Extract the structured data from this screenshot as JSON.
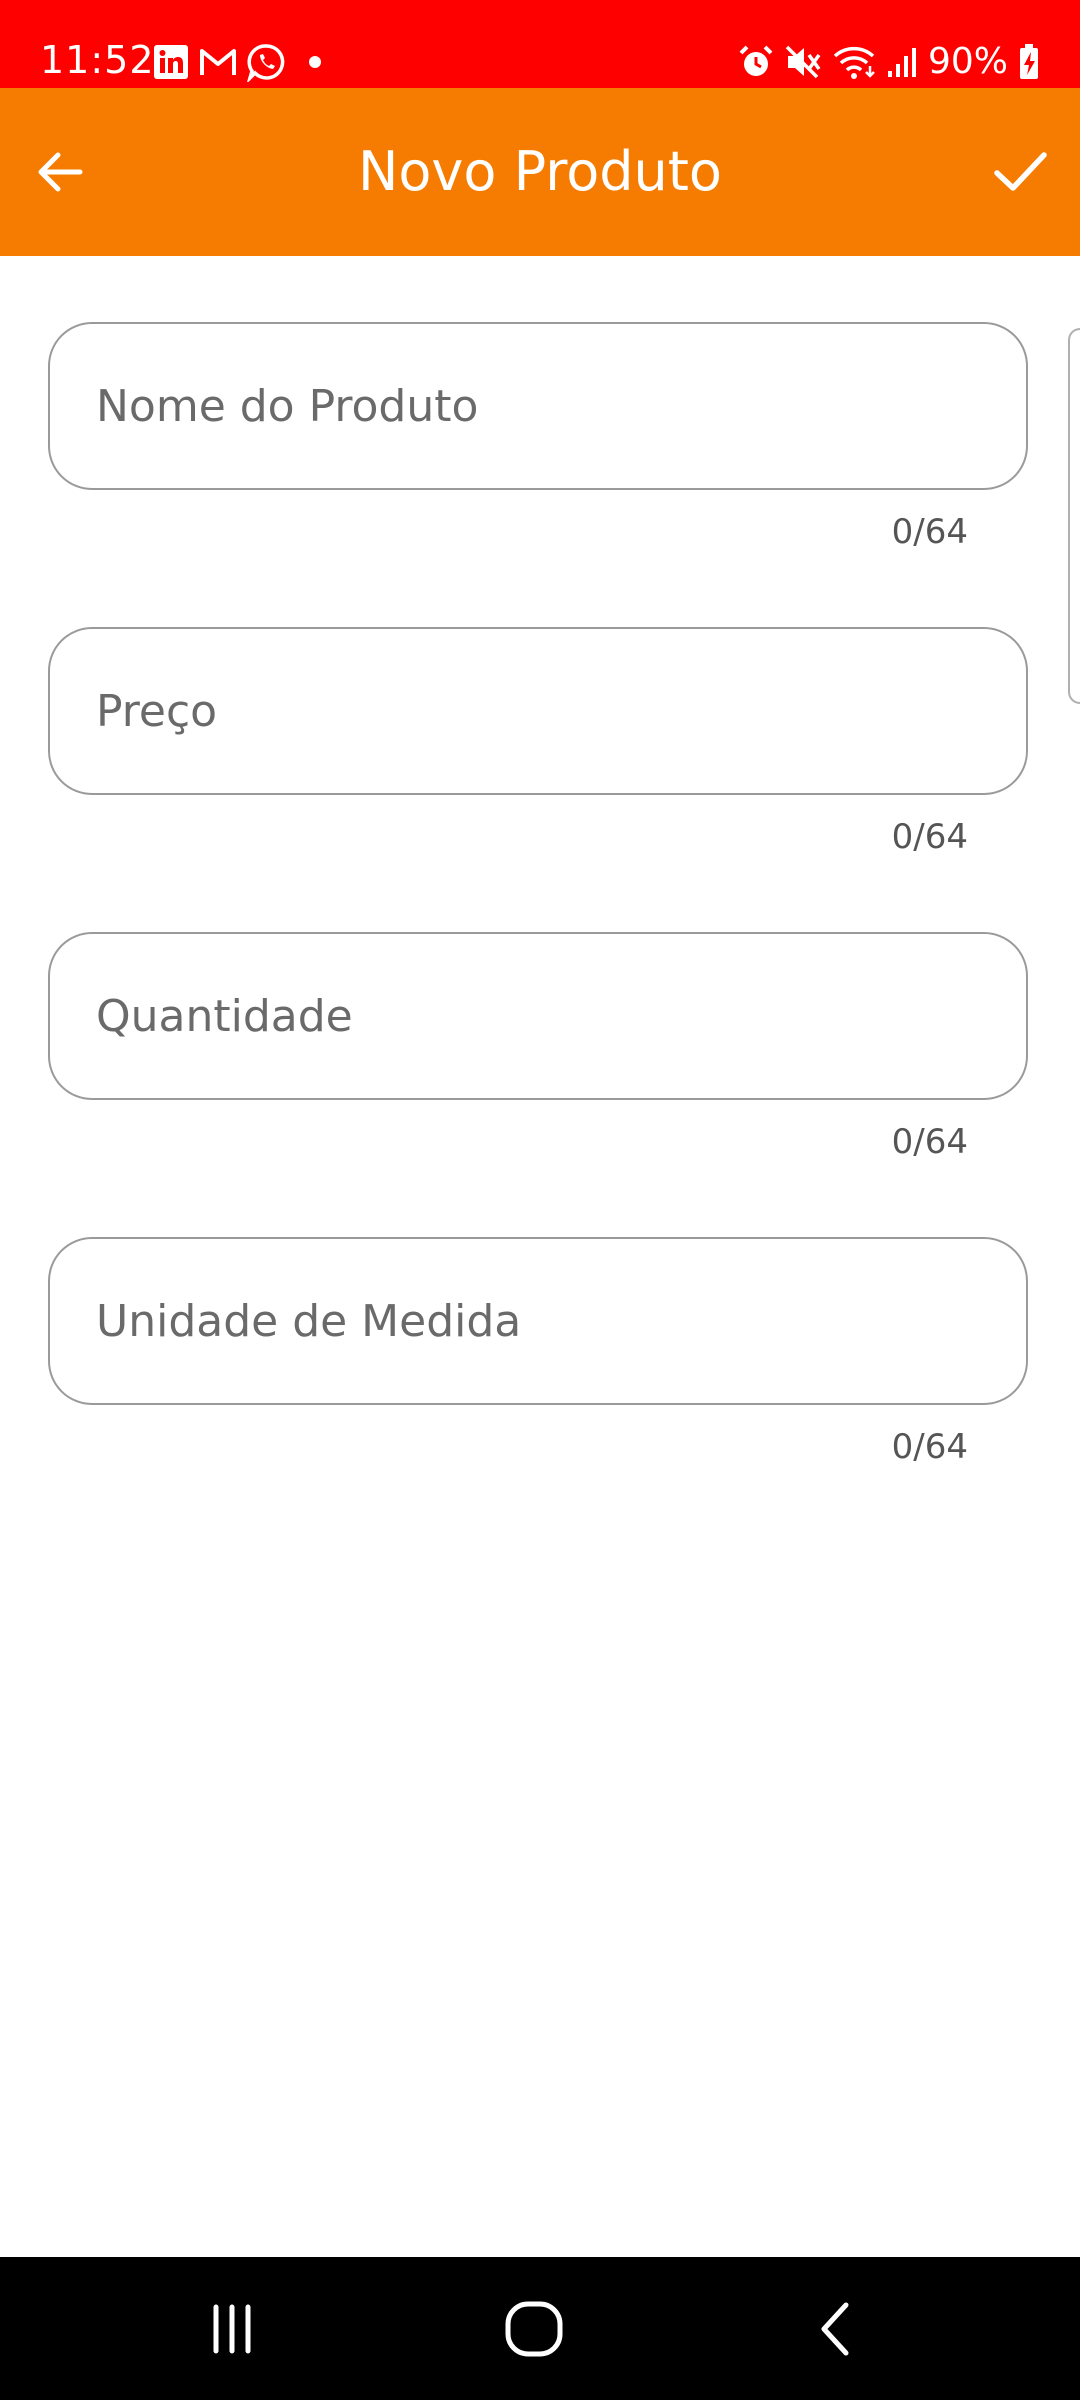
{
  "status_bar": {
    "time": "11:52",
    "notification_icons": [
      "linkedin-icon",
      "gmail-icon",
      "whatsapp-icon",
      "dot-icon"
    ],
    "system_icons": [
      "alarm-icon",
      "mute-icon",
      "wifi-icon",
      "signal-icon"
    ],
    "battery": "90%",
    "background_color": "#ff0000"
  },
  "app_bar": {
    "title": "Novo Produto",
    "back_icon": "arrow-left-icon",
    "confirm_icon": "check-icon",
    "background_color": "#f57c00"
  },
  "form": {
    "fields": [
      {
        "placeholder": "Nome do Produto",
        "value": "",
        "counter": "0/64"
      },
      {
        "placeholder": "Preço",
        "value": "",
        "counter": "0/64"
      },
      {
        "placeholder": "Quantidade",
        "value": "",
        "counter": "0/64"
      },
      {
        "placeholder": "Unidade de Medida",
        "value": "",
        "counter": "0/64"
      }
    ]
  },
  "nav_bar": {
    "buttons": [
      "recents-icon",
      "home-icon",
      "back-icon"
    ]
  }
}
